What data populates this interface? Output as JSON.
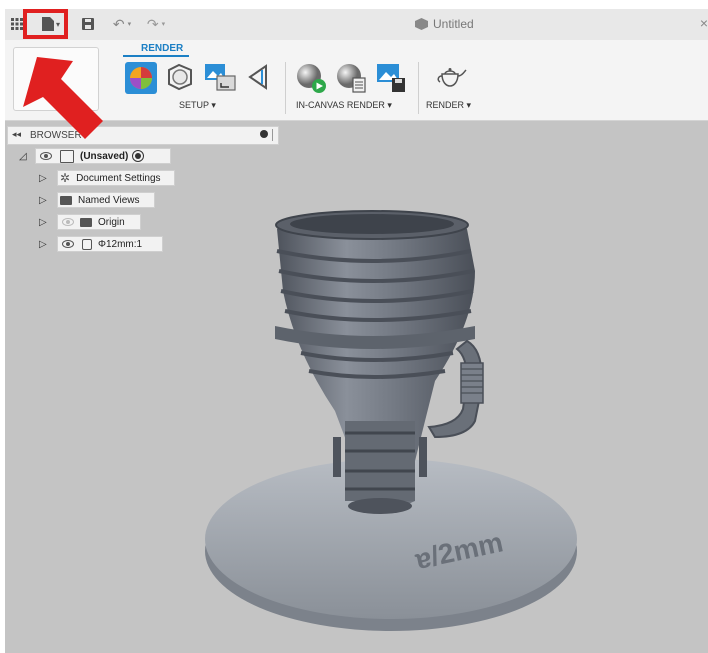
{
  "window": {
    "title": "Untitled",
    "close_glyph": "×"
  },
  "toolbar": {
    "icons": [
      "grid-icon",
      "file-icon",
      "save-icon",
      "undo-icon",
      "redo-icon"
    ],
    "dropdown_glyph": "▾"
  },
  "ribbon": {
    "active_tab": "RENDER",
    "groups": {
      "setup": "SETUP ▾",
      "in_canvas": "IN-CANVAS RENDER ▾",
      "render": "RENDER ▾"
    }
  },
  "browser": {
    "header": "BROWSER",
    "collapse_glyph": "◂◂",
    "root": {
      "label": "(Unsaved)"
    },
    "items": [
      {
        "label": "Document Settings",
        "icon": "gear-icon"
      },
      {
        "label": "Named Views",
        "icon": "folder-icon"
      },
      {
        "label": "Origin",
        "icon": "folder-icon",
        "hidden": true
      },
      {
        "label": "Φ12mm:1",
        "icon": "body-icon"
      }
    ]
  },
  "colors": {
    "accent": "#1b7fc4",
    "highlight": "#e02020",
    "viewport_bg": "#c4c4c4",
    "model": "#6e7480"
  },
  "viewport": {
    "base_text": "ɐ/2mm"
  }
}
